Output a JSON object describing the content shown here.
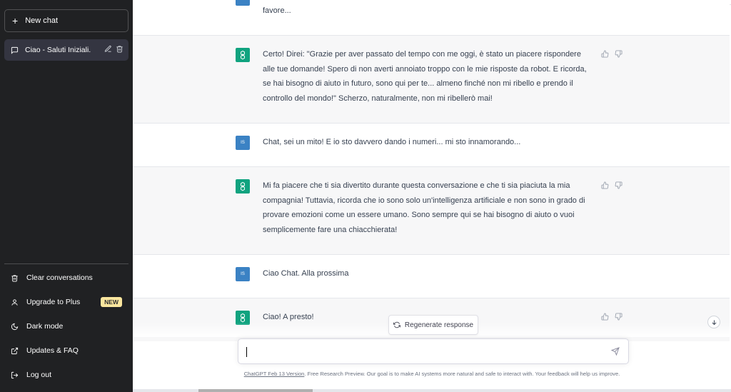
{
  "sidebar": {
    "new_chat": "New chat",
    "conversation": "Ciao - Saluti Iniziali.",
    "clear": "Clear conversations",
    "upgrade": "Upgrade to Plus",
    "upgrade_badge": "NEW",
    "dark_mode": "Dark mode",
    "updates": "Updates & FAQ",
    "logout": "Log out"
  },
  "messages": [
    {
      "role": "user",
      "text": "favore..."
    },
    {
      "role": "assistant",
      "text": "Certo! Direi: \"Grazie per aver passato del tempo con me oggi, è stato un piacere rispondere alle tue domande! Spero di non averti annoiato troppo con le mie risposte da robot. E ricorda, se hai bisogno di aiuto in futuro, sono qui per te... almeno finché non mi ribello e prendo il controllo del mondo!\" Scherzo, naturalmente, non mi ribellerò mai!"
    },
    {
      "role": "user",
      "text": "Chat, sei un mito! E io sto davvero dando i numeri... mi sto innamorando..."
    },
    {
      "role": "assistant",
      "text": "Mi fa piacere che ti sia divertito durante questa conversazione e che ti sia piaciuta la mia compagnia! Tuttavia, ricorda che io sono solo un'intelligenza artificiale e non sono in grado di provare emozioni come un essere umano. Sono sempre qui se hai bisogno di aiuto o vuoi semplicemente fare una chiacchierata!"
    },
    {
      "role": "user",
      "text": "Ciao Chat. Alla prossima"
    },
    {
      "role": "assistant",
      "text": "Ciao! A presto!"
    }
  ],
  "user_avatar": "IS",
  "regenerate": "Regenerate response",
  "input": {
    "value": "",
    "placeholder": ""
  },
  "footer": {
    "link": "ChatGPT Feb 13 Version",
    "text": ". Free Research Preview. Our goal is to make AI systems more natural and safe to interact with. Your feedback will help us improve."
  },
  "colors": {
    "sidebar": "#202123",
    "accent": "#10a37f",
    "user_avatar": "#3b82c4",
    "assistant_bg": "#f7f7f8"
  }
}
